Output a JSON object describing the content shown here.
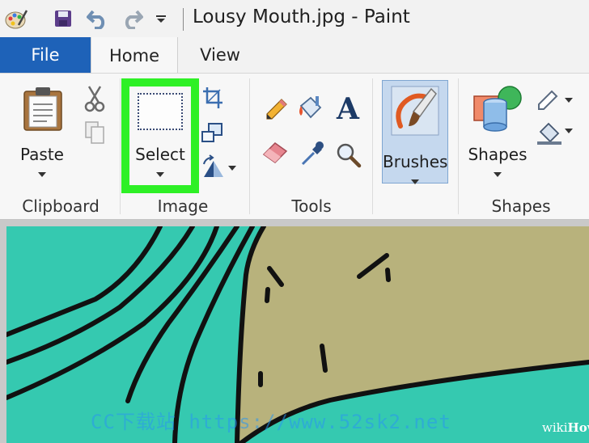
{
  "window": {
    "title": "Lousy Mouth.jpg - Paint"
  },
  "tabs": {
    "file": "File",
    "home": "Home",
    "view": "View"
  },
  "ribbon": {
    "clipboard": {
      "paste_label": "Paste",
      "group_label": "Clipboard"
    },
    "image": {
      "select_label": "Select",
      "group_label": "Image"
    },
    "tools": {
      "group_label": "Tools"
    },
    "brushes": {
      "brushes_label": "Brushes"
    },
    "shapes": {
      "shapes_label": "Shapes",
      "group_label": "Shapes"
    }
  },
  "icons": {
    "app": "paint-palette-icon",
    "save": "save-icon",
    "undo": "undo-icon",
    "redo": "redo-icon",
    "customize": "customize-quick-access-icon",
    "paste": "clipboard-icon",
    "cut": "scissors-icon",
    "copy": "copy-icon",
    "select": "select-rectangle-icon",
    "crop": "crop-icon",
    "resize": "resize-icon",
    "rotate": "rotate-icon",
    "pencil": "pencil-icon",
    "fill": "fill-bucket-icon",
    "text": "text-icon",
    "eraser": "eraser-icon",
    "color_picker": "color-picker-icon",
    "magnifier": "magnifier-icon",
    "brush": "brush-icon",
    "shapes": "shapes-icon",
    "outline": "outline-icon",
    "fill_shape": "shape-fill-icon"
  },
  "colors": {
    "select_highlight": "#2ef026",
    "file_tab": "#1e62b8",
    "canvas_teal": "#35c9b0",
    "canvas_khaki": "#b8b27c"
  },
  "watermarks": {
    "site": "CC下载站 https://www.52sk2.net",
    "brand_light": "wiki",
    "brand_bold": "How"
  }
}
